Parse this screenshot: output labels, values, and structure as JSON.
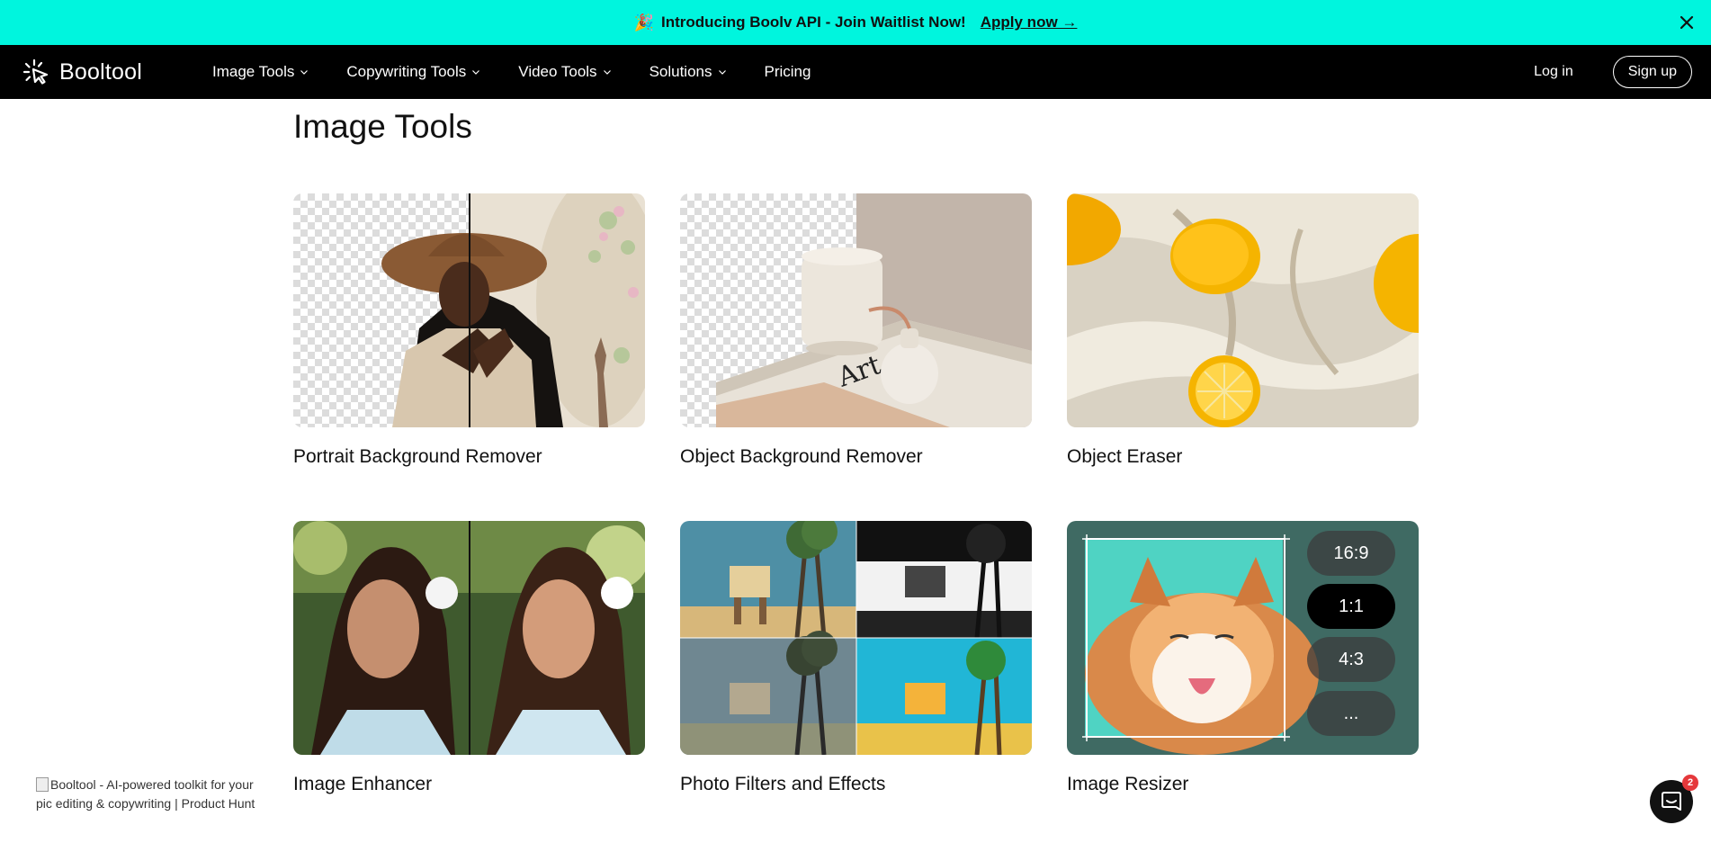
{
  "banner": {
    "emoji": "🎉",
    "text": "Introducing Boolv API - Join Waitlist Now!",
    "link": "Apply now →"
  },
  "nav": {
    "brand": "Booltool",
    "menu": [
      {
        "label": "Image Tools",
        "dropdown": true
      },
      {
        "label": "Copywriting Tools",
        "dropdown": true
      },
      {
        "label": "Video Tools",
        "dropdown": true
      },
      {
        "label": "Solutions",
        "dropdown": true
      },
      {
        "label": "Pricing",
        "dropdown": false
      }
    ],
    "login": "Log in",
    "signup": "Sign up"
  },
  "main": {
    "title": "Image Tools",
    "cards": [
      {
        "title": "Portrait Background Remover"
      },
      {
        "title": "Object Background Remover"
      },
      {
        "title": "Object Eraser"
      },
      {
        "title": "Image Enhancer"
      },
      {
        "title": "Photo Filters and Effects"
      },
      {
        "title": "Image Resizer"
      }
    ],
    "ratios": [
      "16:9",
      "1:1",
      "4:3",
      "..."
    ]
  },
  "product_hunt": {
    "alt": "Booltool - AI-powered toolkit for your pic editing & copywriting | Product Hunt"
  },
  "chat": {
    "badge": "2"
  },
  "colors": {
    "banner": "#00f5de",
    "nav": "#000000",
    "accent_badge": "#e5383b"
  }
}
